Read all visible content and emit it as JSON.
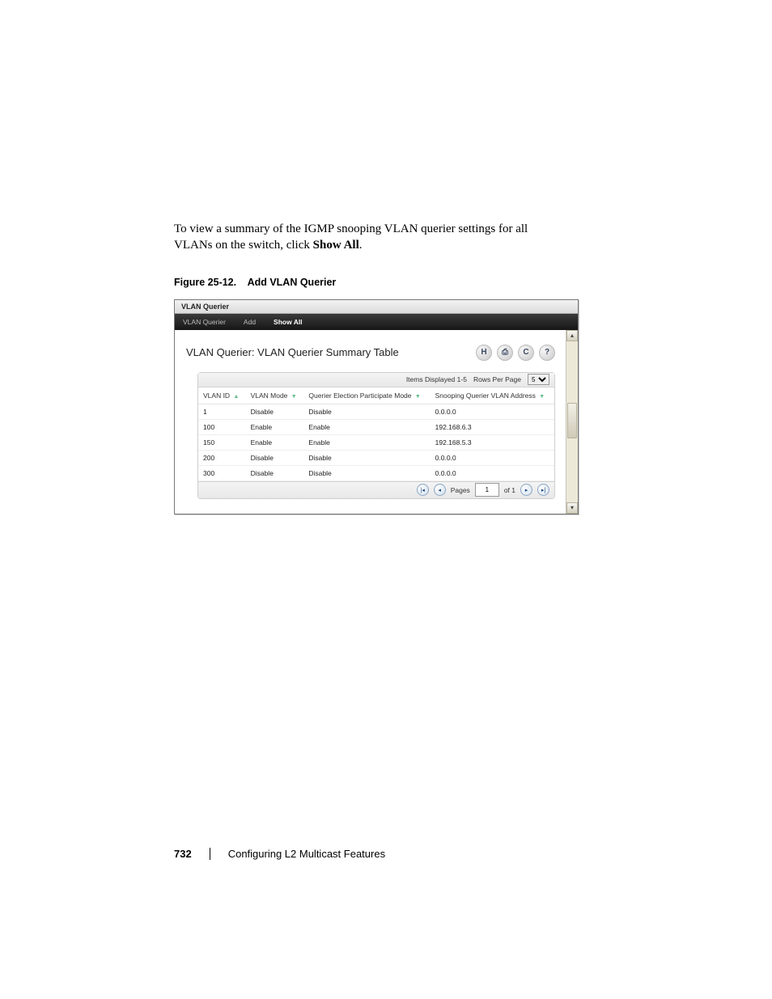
{
  "intro_line1": "To view a summary of the IGMP snooping VLAN querier settings for all",
  "intro_line2_a": "VLANs on the switch, click ",
  "intro_line2_b": "Show All",
  "intro_line2_c": ".",
  "fig_number": "Figure 25-12.",
  "fig_title": "Add VLAN Querier",
  "window_title": "VLAN Querier",
  "tabs": {
    "t0": "VLAN Querier",
    "t1": "Add",
    "t2": "Show All"
  },
  "page_heading": "VLAN Querier: VLAN Querier Summary Table",
  "items_displayed": "Items Displayed 1-5",
  "rows_per_page_label": "Rows Per Page",
  "rows_per_page_value": "5",
  "col": {
    "vlanid": "VLAN ID",
    "vlanmode": "VLAN Mode",
    "qepm": "Querier Election Participate Mode",
    "addr": "Snooping Querier VLAN Address"
  },
  "rows": [
    {
      "id": "1",
      "mode": "Disable",
      "qepm": "Disable",
      "addr": "0.0.0.0"
    },
    {
      "id": "100",
      "mode": "Enable",
      "qepm": "Enable",
      "addr": "192.168.6.3"
    },
    {
      "id": "150",
      "mode": "Enable",
      "qepm": "Enable",
      "addr": "192.168.5.3"
    },
    {
      "id": "200",
      "mode": "Disable",
      "qepm": "Disable",
      "addr": "0.0.0.0"
    },
    {
      "id": "300",
      "mode": "Disable",
      "qepm": "Disable",
      "addr": "0.0.0.0"
    }
  ],
  "pager": {
    "label": "Pages",
    "page": "1",
    "of": "of 1"
  },
  "footer": {
    "page": "732",
    "chapter": "Configuring L2 Multicast Features"
  }
}
